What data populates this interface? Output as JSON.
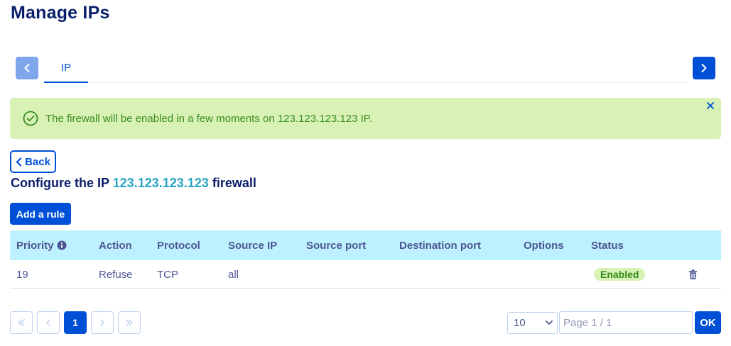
{
  "page": {
    "title": "Manage IPs"
  },
  "tabs": {
    "items": [
      {
        "label": "IP",
        "active": true
      }
    ]
  },
  "alert": {
    "message": "The firewall will be enabled in a few moments on 123.123.123.123 IP.",
    "type": "success"
  },
  "back": {
    "label": "Back"
  },
  "section": {
    "title_prefix": "Configure the IP",
    "ip": "123.123.123.123",
    "title_suffix": "firewall"
  },
  "toolbar": {
    "add_rule_label": "Add a rule"
  },
  "table": {
    "columns": [
      "Priority",
      "Action",
      "Protocol",
      "Source IP",
      "Source port",
      "Destination port",
      "Options",
      "Status"
    ],
    "rows": [
      {
        "priority": "19",
        "action": "Refuse",
        "protocol": "TCP",
        "source_ip": "all",
        "source_port": "",
        "destination_port": "",
        "options": "",
        "status": "Enabled"
      }
    ]
  },
  "pagination": {
    "current_page": "1",
    "page_size": "10",
    "page_placeholder": "Page 1 / 1",
    "ok_label": "OK"
  },
  "colors": {
    "primary": "#0050d7",
    "title": "#0a1f6b",
    "success_bg": "#d8f1b4",
    "success_text": "#3b8d22",
    "table_header_bg": "#bef1ff",
    "ip_highlight": "#28a5c0"
  },
  "icons": {
    "tab_prev": "chevron-left-icon",
    "tab_next": "chevron-right-icon",
    "alert": "check-circle-icon",
    "alert_close": "close-icon",
    "back": "chevron-left-icon",
    "priority_info": "info-icon",
    "row_delete": "trash-icon",
    "page_first": "double-chevron-left-icon",
    "page_prev": "chevron-left-icon",
    "page_next": "chevron-right-icon",
    "page_last": "double-chevron-right-icon",
    "page_size": "chevron-down-icon"
  }
}
